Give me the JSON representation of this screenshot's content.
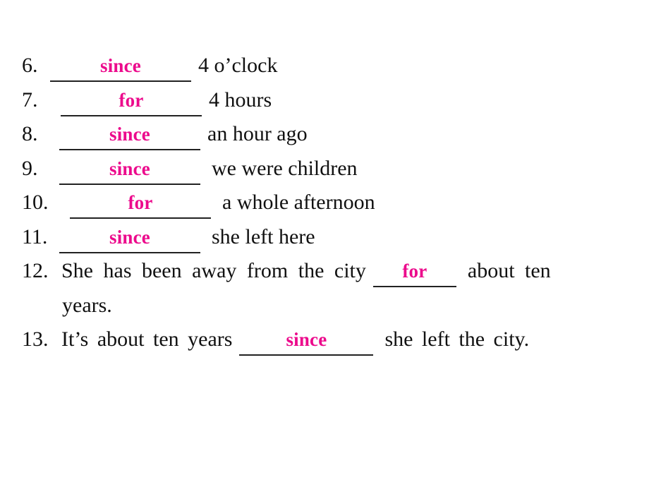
{
  "page": {
    "background_color": "#ffffff",
    "text_color": "#111111",
    "answer_color": "#ec0a8c",
    "blank_line_color": "#222222"
  },
  "exercise": {
    "items": [
      {
        "number": "6.",
        "lead": "",
        "answer": "since",
        "tail": "4 o’clock",
        "blank_width": 200
      },
      {
        "number": "7.",
        "lead": "",
        "answer": "for",
        "tail": "4 hours",
        "blank_width": 200
      },
      {
        "number": "8.",
        "lead": "",
        "answer": "since",
        "tail": "an hour ago",
        "blank_width": 200
      },
      {
        "number": "9.",
        "lead": "",
        "answer": "since",
        "tail": "we were children",
        "blank_width": 200
      },
      {
        "number": "10.",
        "lead": "",
        "answer": "for",
        "tail": "a whole afternoon",
        "blank_width": 200
      },
      {
        "number": "11.",
        "lead": "",
        "answer": "since",
        "tail": "she left here",
        "blank_width": 200
      },
      {
        "number": "12.",
        "lead": "She has been away from the city",
        "answer": "for",
        "tail": "about ten",
        "continuation": "years.",
        "blank_width": 118
      },
      {
        "number": "13.",
        "lead": "It’s about ten years",
        "answer": "since",
        "tail": "she left the city.",
        "blank_width": 190
      }
    ]
  }
}
